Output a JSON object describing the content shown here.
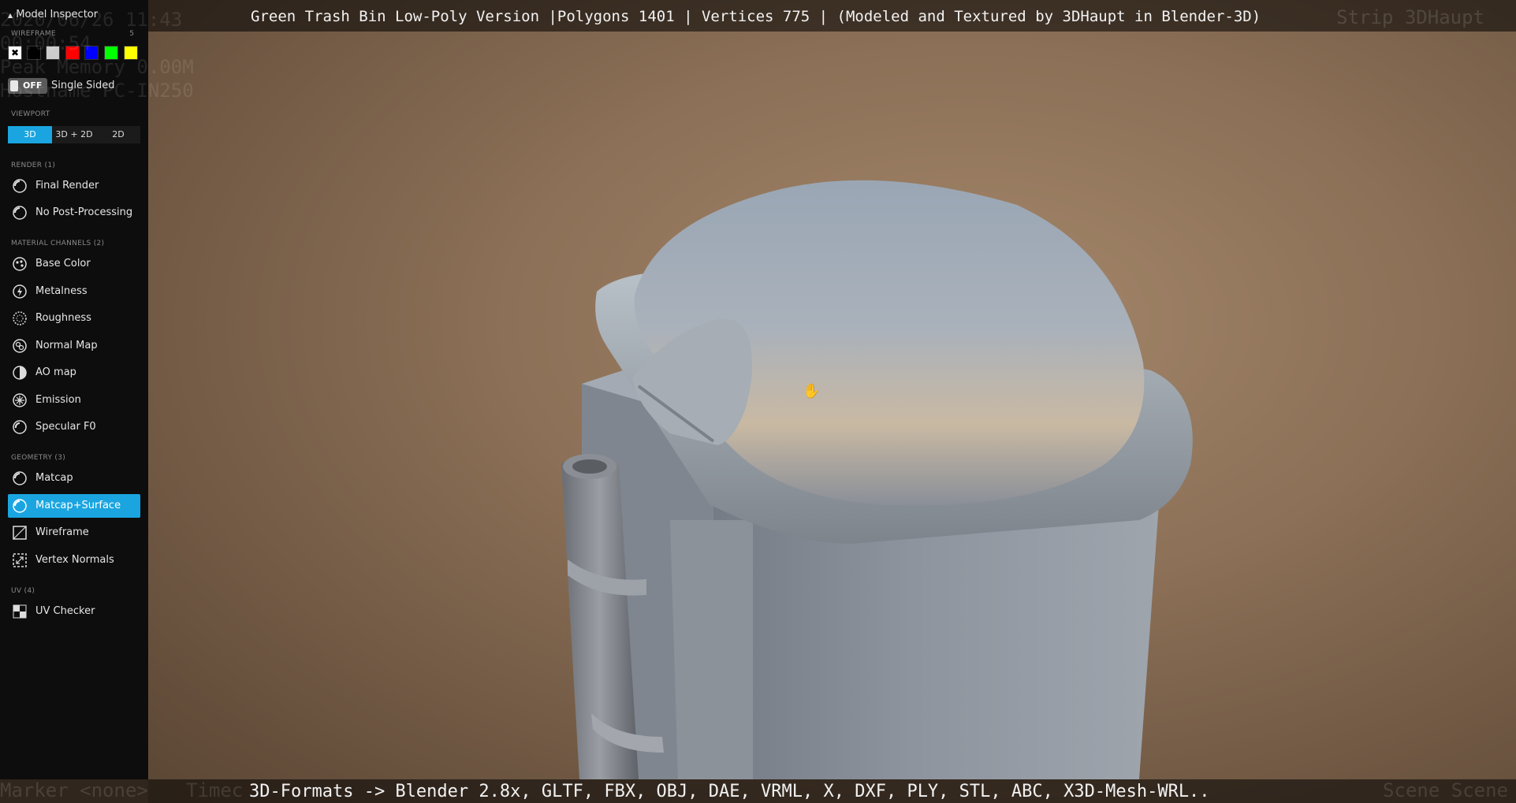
{
  "title_bar": {
    "text": "Green Trash Bin Low-Poly Version |Polygons 1401 | Vertices 775 | (Modeled and Textured by 3DHaupt in Blender-3D)",
    "ghost": "Strip 3DHaupt"
  },
  "bottom_bar": {
    "text": "3D-Formats -> Blender 2.8x, GLTF, FBX, OBJ, DAE, VRML, X, DXF, PLY, STL, ABC, X3D-Mesh-WRL..",
    "ghost_left": "Marker <none>",
    "ghost_mid": "Timec",
    "ghost_right": "Scene Scene"
  },
  "ghost_overlay": {
    "line1": "2020/06/26 11:43",
    "line2": "00:00:54",
    "line3": "Peak Memory 0.00M",
    "line4": "Hostname PC-IN250"
  },
  "sidebar": {
    "title": "Model Inspector",
    "collapse_icon": "triangle-up",
    "wireframe": {
      "label": "WIREFRAME",
      "count": "5",
      "colors": [
        "#ffffff",
        "#000000",
        "#cccccc",
        "#ff0000",
        "#0000ff",
        "#00ff00",
        "#ffff00"
      ]
    },
    "single_sided": {
      "toggle": "OFF",
      "label": "Single Sided"
    },
    "viewport": {
      "label": "VIEWPORT",
      "options": [
        "3D",
        "3D + 2D",
        "2D"
      ],
      "selected": "3D"
    },
    "render": {
      "label": "RENDER (1)",
      "items": [
        "Final Render",
        "No Post-Processing"
      ]
    },
    "material": {
      "label": "MATERIAL CHANNELS (2)",
      "items": [
        "Base Color",
        "Metalness",
        "Roughness",
        "Normal Map",
        "AO map",
        "Emission",
        "Specular F0"
      ]
    },
    "geometry": {
      "label": "GEOMETRY (3)",
      "items": [
        "Matcap",
        "Matcap+Surface",
        "Wireframe",
        "Vertex Normals"
      ],
      "selected": "Matcap+Surface"
    },
    "uv": {
      "label": "UV (4)",
      "items": [
        "UV Checker"
      ]
    }
  },
  "colors": {
    "accent": "#1aa5e0",
    "sidebar_bg": "#0d0d0d"
  }
}
